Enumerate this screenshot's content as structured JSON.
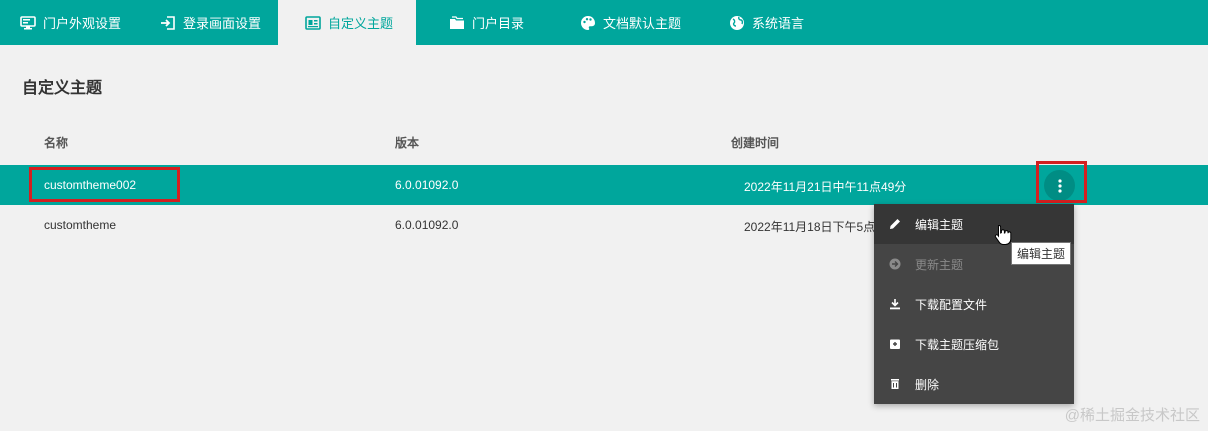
{
  "tabs": [
    {
      "label": "门户外观设置",
      "icon": "monitor-icon",
      "active": false
    },
    {
      "label": "登录画面设置",
      "icon": "login-icon",
      "active": false
    },
    {
      "label": "自定义主题",
      "icon": "theme-card-icon",
      "active": true
    },
    {
      "label": "门户目录",
      "icon": "folders-icon",
      "active": false
    },
    {
      "label": "文档默认主题",
      "icon": "palette-icon",
      "active": false
    },
    {
      "label": "系统语言",
      "icon": "globe-icon",
      "active": false
    }
  ],
  "page": {
    "title": "自定义主题"
  },
  "table": {
    "headers": [
      "名称",
      "版本",
      "创建时间"
    ],
    "rows": [
      {
        "name": "customtheme002",
        "version": "6.0.01092.0",
        "created": "2022年11月21日中午11点49分",
        "selected": true
      },
      {
        "name": "customtheme",
        "version": "6.0.01092.0",
        "created": "2022年11月18日下午5点",
        "selected": false
      }
    ]
  },
  "menu": {
    "items": [
      {
        "label": "编辑主题",
        "icon": "pencil-icon",
        "state": "hover"
      },
      {
        "label": "更新主题",
        "icon": "arrow-circle-icon",
        "state": "disabled"
      },
      {
        "label": "下载配置文件",
        "icon": "download-icon",
        "state": "normal"
      },
      {
        "label": "下载主题压缩包",
        "icon": "archive-icon",
        "state": "normal"
      },
      {
        "label": "删除",
        "icon": "trash-icon",
        "state": "normal"
      }
    ]
  },
  "tooltip": {
    "text": "编辑主题"
  },
  "watermark": {
    "text": "@稀土掘金技术社区"
  },
  "colors": {
    "accent": "#00a69c",
    "accent_dark": "#008d84",
    "menu_bg": "#454545",
    "highlight": "#d32020",
    "background": "#f1f1f1"
  }
}
